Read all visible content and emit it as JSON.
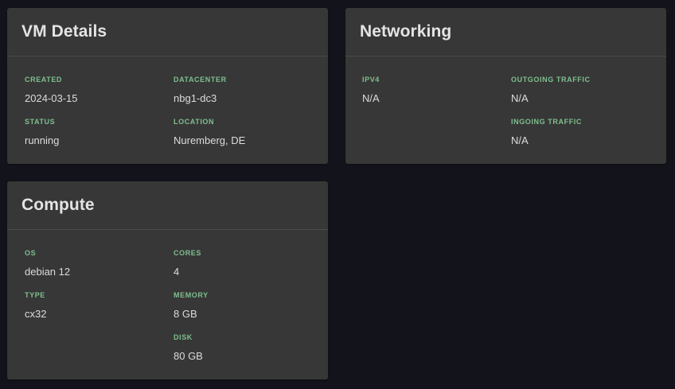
{
  "vm_details": {
    "title": "VM Details",
    "created_label": "CREATED",
    "created_value": "2024-03-15",
    "datacenter_label": "DATACENTER",
    "datacenter_value": "nbg1-dc3",
    "status_label": "STATUS",
    "status_value": "running",
    "location_label": "LOCATION",
    "location_value": "Nuremberg, DE"
  },
  "networking": {
    "title": "Networking",
    "ipv4_label": "IPV4",
    "ipv4_value": "N/A",
    "outgoing_label": "OUTGOING TRAFFIC",
    "outgoing_value": "N/A",
    "ingoing_label": "INGOING TRAFFIC",
    "ingoing_value": "N/A"
  },
  "compute": {
    "title": "Compute",
    "os_label": "OS",
    "os_value": "debian 12",
    "cores_label": "CORES",
    "cores_value": "4",
    "type_label": "TYPE",
    "type_value": "cx32",
    "memory_label": "MEMORY",
    "memory_value": "8 GB",
    "disk_label": "DISK",
    "disk_value": "80 GB"
  },
  "colors": {
    "background": "#13141b",
    "card": "#373737",
    "label_accent": "#7fbf8f",
    "text": "#dcdcdc"
  }
}
